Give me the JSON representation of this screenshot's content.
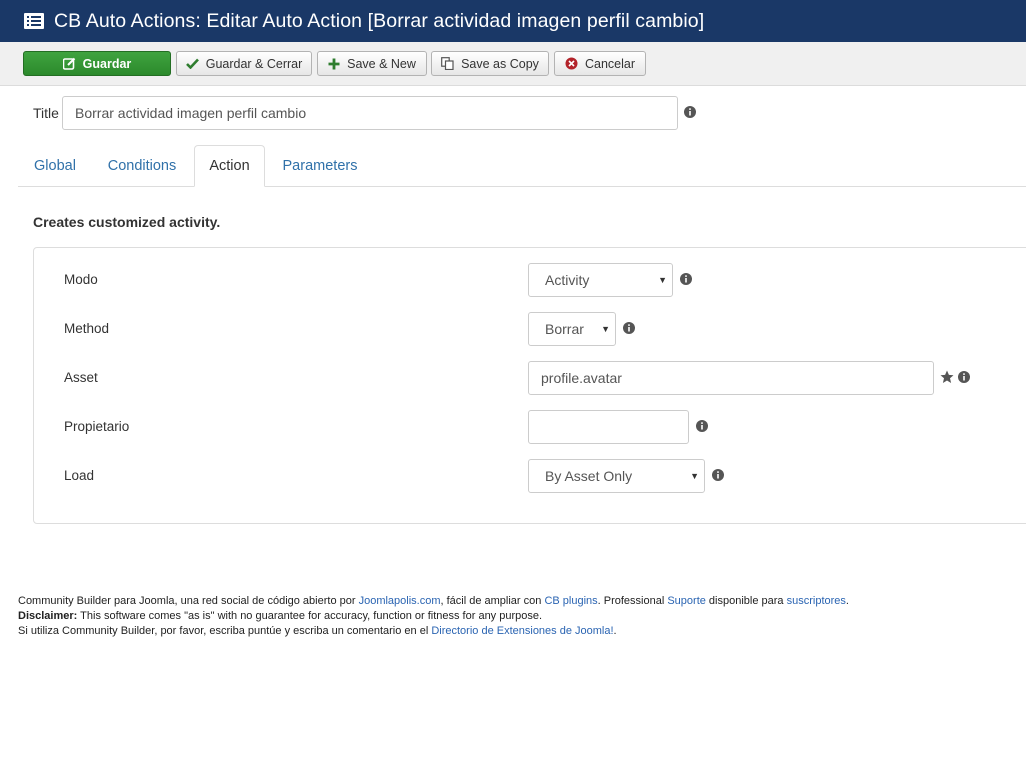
{
  "header": {
    "title": "CB Auto Actions: Editar Auto Action [Borrar actividad imagen perfil cambio]",
    "icon": "list-icon"
  },
  "toolbar": {
    "save_label": "Guardar",
    "save_close_label": "Guardar & Cerrar",
    "save_new_label": "Save & New",
    "save_copy_label": "Save as Copy",
    "cancel_label": "Cancelar"
  },
  "title_field": {
    "label": "Title",
    "value": "Borrar actividad imagen perfil cambio"
  },
  "tabs": [
    {
      "label": "Global"
    },
    {
      "label": "Conditions"
    },
    {
      "label": "Action"
    },
    {
      "label": "Parameters"
    }
  ],
  "active_tab": "Action",
  "description": "Creates customized activity.",
  "form": {
    "mode": {
      "label": "Modo",
      "value": "Activity"
    },
    "method": {
      "label": "Method",
      "value": "Borrar"
    },
    "asset": {
      "label": "Asset",
      "value": "profile.avatar"
    },
    "owner": {
      "label": "Propietario",
      "value": ""
    },
    "load": {
      "label": "Load",
      "value": "By Asset Only"
    }
  },
  "footer": {
    "line1_a": "Community Builder para Joomla, una red social de código abierto por ",
    "line1_link1": "Joomlapolis.com",
    "line1_b": ", fácil de ampliar con ",
    "line1_link2": "CB plugins",
    "line1_c": ". Professional ",
    "line1_link3": "Suporte",
    "line1_d": " disponible para ",
    "line1_link4": "suscriptores",
    "line1_e": ".",
    "line2_bold": "Disclaimer:",
    "line2_text": " This software comes \"as is\" with no guarantee for accuracy, function or fitness for any purpose.",
    "line3_text": "Si utiliza Community Builder, por favor, escriba puntúe y escriba un comentario en el ",
    "line3_link": "Directorio de Extensiones de Joomla!",
    "line3_end": "."
  },
  "colors": {
    "header_bg": "#1a3867",
    "save_green": "#2c8a2c",
    "link_blue": "#3071a9"
  }
}
